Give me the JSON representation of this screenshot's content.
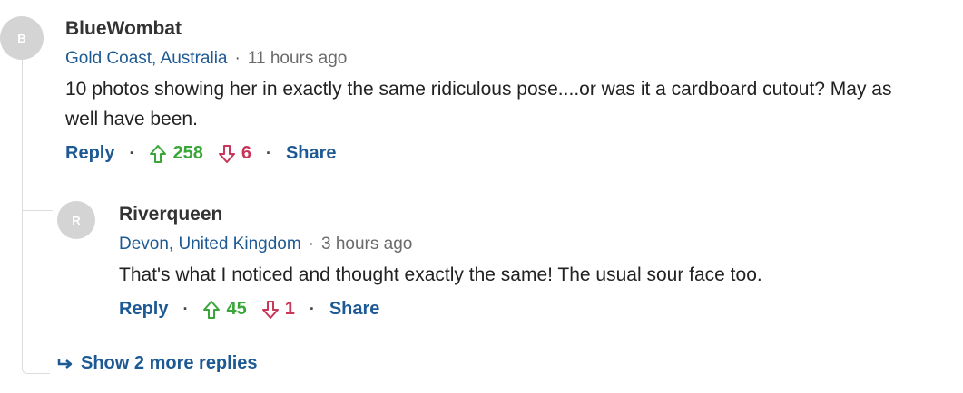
{
  "comments": [
    {
      "avatar_letter": "B",
      "username": "BlueWombat",
      "location": "Gold Coast, Australia",
      "separator": "·",
      "time": "11 hours ago",
      "text": "10 photos showing her in exactly the same ridiculous pose....or was it a cardboard cutout? May as well have been.",
      "reply_label": "Reply",
      "upvotes": "258",
      "downvotes": "6",
      "share_label": "Share"
    }
  ],
  "replies": [
    {
      "avatar_letter": "R",
      "username": "Riverqueen",
      "location": "Devon, United Kingdom",
      "separator": "·",
      "time": "3 hours ago",
      "text": "That's what I noticed and thought exactly the same! The usual sour face too.",
      "reply_label": "Reply",
      "upvotes": "45",
      "downvotes": "1",
      "share_label": "Share"
    }
  ],
  "show_more_label": "Show 2 more replies",
  "colors": {
    "link": "#1d5a94",
    "upvote": "#3aa63a",
    "downvote": "#c8365a",
    "avatar_bg": "#d4d4d4"
  },
  "icons": {
    "upvote": "arrow-up-outline",
    "downvote": "arrow-down-outline",
    "show_more": "reply-arrow"
  }
}
